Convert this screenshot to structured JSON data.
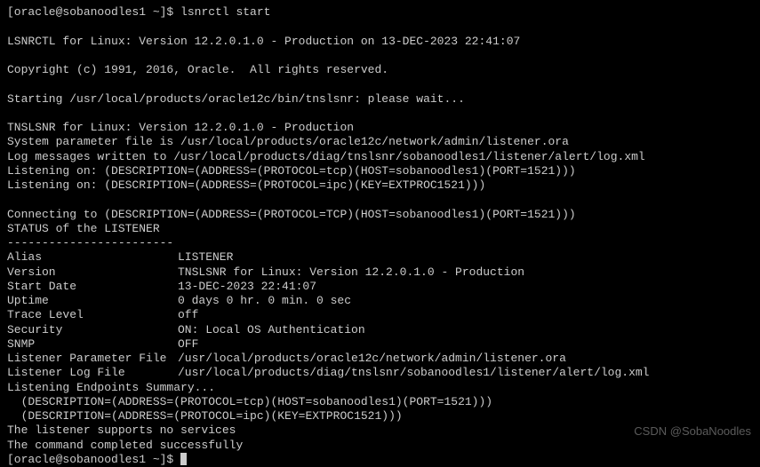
{
  "prompt": {
    "user_host1": "[oracle@sobanoodles1 ~]$ ",
    "cmd": "lsnrctl start",
    "user_host2": "[oracle@sobanoodles1 ~]$ "
  },
  "header": {
    "l1": "LSNRCTL for Linux: Version 12.2.0.1.0 - Production on 13-DEC-2023 22:41:07",
    "l2": "Copyright (c) 1991, 2016, Oracle.  All rights reserved.",
    "l3": "Starting /usr/local/products/oracle12c/bin/tnslsnr: please wait..."
  },
  "tnslsnr": {
    "l1": "TNSLSNR for Linux: Version 12.2.0.1.0 - Production",
    "l2": "System parameter file is /usr/local/products/oracle12c/network/admin/listener.ora",
    "l3": "Log messages written to /usr/local/products/diag/tnslsnr/sobanoodles1/listener/alert/log.xml",
    "l4": "Listening on: (DESCRIPTION=(ADDRESS=(PROTOCOL=tcp)(HOST=sobanoodles1)(PORT=1521)))",
    "l5": "Listening on: (DESCRIPTION=(ADDRESS=(PROTOCOL=ipc)(KEY=EXTPROC1521)))"
  },
  "status": {
    "connecting": "Connecting to (DESCRIPTION=(ADDRESS=(PROTOCOL=TCP)(HOST=sobanoodles1)(PORT=1521)))",
    "header": "STATUS of the LISTENER",
    "sep": "------------------------",
    "alias_k": "Alias",
    "alias_v": "LISTENER",
    "version_k": "Version",
    "version_v": "TNSLSNR for Linux: Version 12.2.0.1.0 - Production",
    "startdate_k": "Start Date",
    "startdate_v": "13-DEC-2023 22:41:07",
    "uptime_k": "Uptime",
    "uptime_v": "0 days 0 hr. 0 min. 0 sec",
    "trace_k": "Trace Level",
    "trace_v": "off",
    "security_k": "Security",
    "security_v": "ON: Local OS Authentication",
    "snmp_k": "SNMP",
    "snmp_v": "OFF",
    "paramfile_k": "Listener Parameter File",
    "paramfile_v": "/usr/local/products/oracle12c/network/admin/listener.ora",
    "logfile_k": "Listener Log File",
    "logfile_v": "/usr/local/products/diag/tnslsnr/sobanoodles1/listener/alert/log.xml"
  },
  "endpoints": {
    "header": "Listening Endpoints Summary...",
    "e1": "  (DESCRIPTION=(ADDRESS=(PROTOCOL=tcp)(HOST=sobanoodles1)(PORT=1521)))",
    "e2": "  (DESCRIPTION=(ADDRESS=(PROTOCOL=ipc)(KEY=EXTPROC1521)))"
  },
  "footer": {
    "l1": "The listener supports no services",
    "l2": "The command completed successfully"
  },
  "watermark": "CSDN @SobaNoodles"
}
